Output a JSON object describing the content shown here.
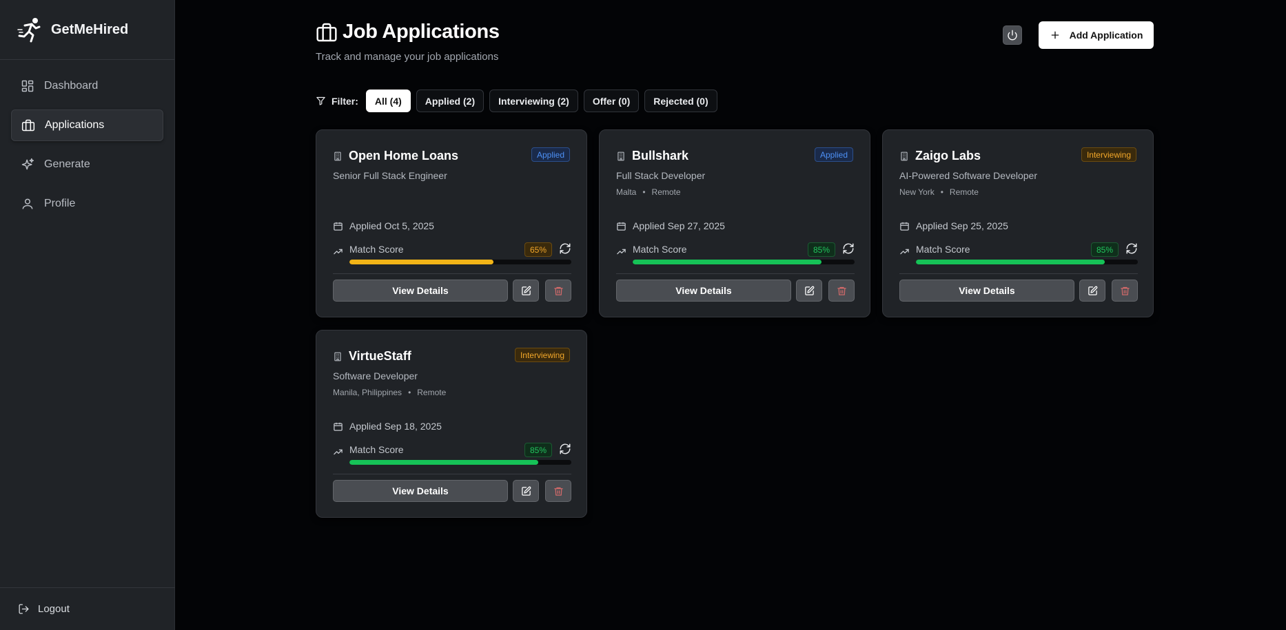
{
  "app": {
    "name": "GetMeHired"
  },
  "sidebar": {
    "items": [
      {
        "label": "Dashboard",
        "icon": "dashboard-icon",
        "active": false
      },
      {
        "label": "Applications",
        "icon": "briefcase-icon",
        "active": true
      },
      {
        "label": "Generate",
        "icon": "sparkles-icon",
        "active": false
      },
      {
        "label": "Profile",
        "icon": "user-icon",
        "active": false
      }
    ],
    "logout_label": "Logout"
  },
  "header": {
    "title": "Job Applications",
    "subtitle": "Track and manage your job applications",
    "add_label": "Add Application"
  },
  "filter": {
    "label": "Filter:",
    "chips": [
      {
        "label": "All (4)",
        "active": true
      },
      {
        "label": "Applied (2)",
        "active": false
      },
      {
        "label": "Interviewing (2)",
        "active": false
      },
      {
        "label": "Offer (0)",
        "active": false
      },
      {
        "label": "Rejected (0)",
        "active": false
      }
    ]
  },
  "labels": {
    "match_score": "Match Score",
    "view_details": "View Details",
    "location_separator": "•"
  },
  "colors": {
    "amber": "#f2b417",
    "green": "#16c257"
  },
  "applications": [
    {
      "company": "Open Home Loans",
      "status": "Applied",
      "role": "Senior Full Stack Engineer",
      "location": "",
      "work_mode": "",
      "applied": "Applied Oct 5, 2025",
      "score_label": "65%",
      "score": 0.65
    },
    {
      "company": "Bullshark",
      "status": "Applied",
      "role": "Full Stack Developer",
      "location": "Malta",
      "work_mode": "Remote",
      "applied": "Applied Sep 27, 2025",
      "score_label": "85%",
      "score": 0.85
    },
    {
      "company": "Zaigo Labs",
      "status": "Interviewing",
      "role": "AI-Powered Software Developer",
      "location": "New York",
      "work_mode": "Remote",
      "applied": "Applied Sep 25, 2025",
      "score_label": "85%",
      "score": 0.85
    },
    {
      "company": "VirtueStaff",
      "status": "Interviewing",
      "role": "Software Developer",
      "location": "Manila, Philippines",
      "work_mode": "Remote",
      "applied": "Applied Sep 18, 2025",
      "score_label": "85%",
      "score": 0.85
    }
  ]
}
